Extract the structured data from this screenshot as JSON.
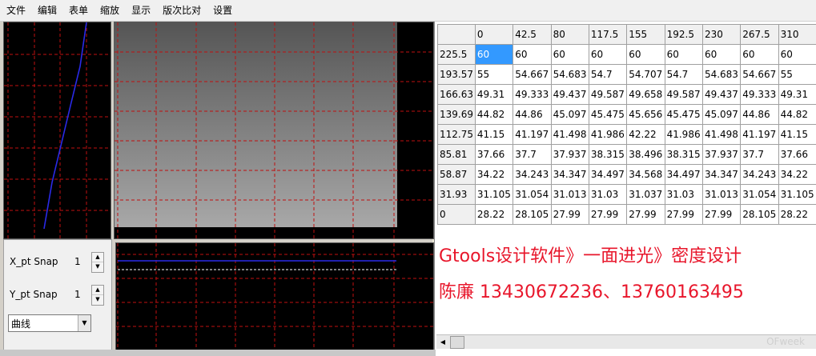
{
  "menu": [
    "文件",
    "编辑",
    "表单",
    "缩放",
    "显示",
    "版次比对",
    "设置"
  ],
  "controls": {
    "x_label": "X_pt Snap",
    "x_value": "1",
    "y_label": "Y_pt Snap",
    "y_value": "1",
    "combo_value": "曲线"
  },
  "table": {
    "header": [
      "",
      "0",
      "42.5",
      "80",
      "117.5",
      "155",
      "192.5",
      "230",
      "267.5",
      "310"
    ],
    "rows": [
      [
        "225.5",
        "60",
        "60",
        "60",
        "60",
        "60",
        "60",
        "60",
        "60",
        "60"
      ],
      [
        "193.57",
        "55",
        "54.667",
        "54.683",
        "54.7",
        "54.707",
        "54.7",
        "54.683",
        "54.667",
        "55"
      ],
      [
        "166.63",
        "49.31",
        "49.333",
        "49.437",
        "49.587",
        "49.658",
        "49.587",
        "49.437",
        "49.333",
        "49.31"
      ],
      [
        "139.69",
        "44.82",
        "44.86",
        "45.097",
        "45.475",
        "45.656",
        "45.475",
        "45.097",
        "44.86",
        "44.82"
      ],
      [
        "112.75",
        "41.15",
        "41.197",
        "41.498",
        "41.986",
        "42.22",
        "41.986",
        "41.498",
        "41.197",
        "41.15"
      ],
      [
        "85.81",
        "37.66",
        "37.7",
        "37.937",
        "38.315",
        "38.496",
        "38.315",
        "37.937",
        "37.7",
        "37.66"
      ],
      [
        "58.87",
        "34.22",
        "34.243",
        "34.347",
        "34.497",
        "34.568",
        "34.497",
        "34.347",
        "34.243",
        "34.22"
      ],
      [
        "31.93",
        "31.105",
        "31.054",
        "31.013",
        "31.03",
        "31.037",
        "31.03",
        "31.013",
        "31.054",
        "31.105"
      ],
      [
        "0",
        "28.22",
        "28.105",
        "27.99",
        "27.99",
        "27.99",
        "27.99",
        "27.99",
        "28.105",
        "28.22"
      ]
    ]
  },
  "overlay": {
    "line1": "Gtools设计软件》一面进光》密度设计",
    "line2": "陈廉    13430672236、13760163495"
  },
  "watermark": "OFweek",
  "colors": {
    "red_text": "#e8162b",
    "grid_red": "#c01010",
    "selection": "#3399ff"
  }
}
